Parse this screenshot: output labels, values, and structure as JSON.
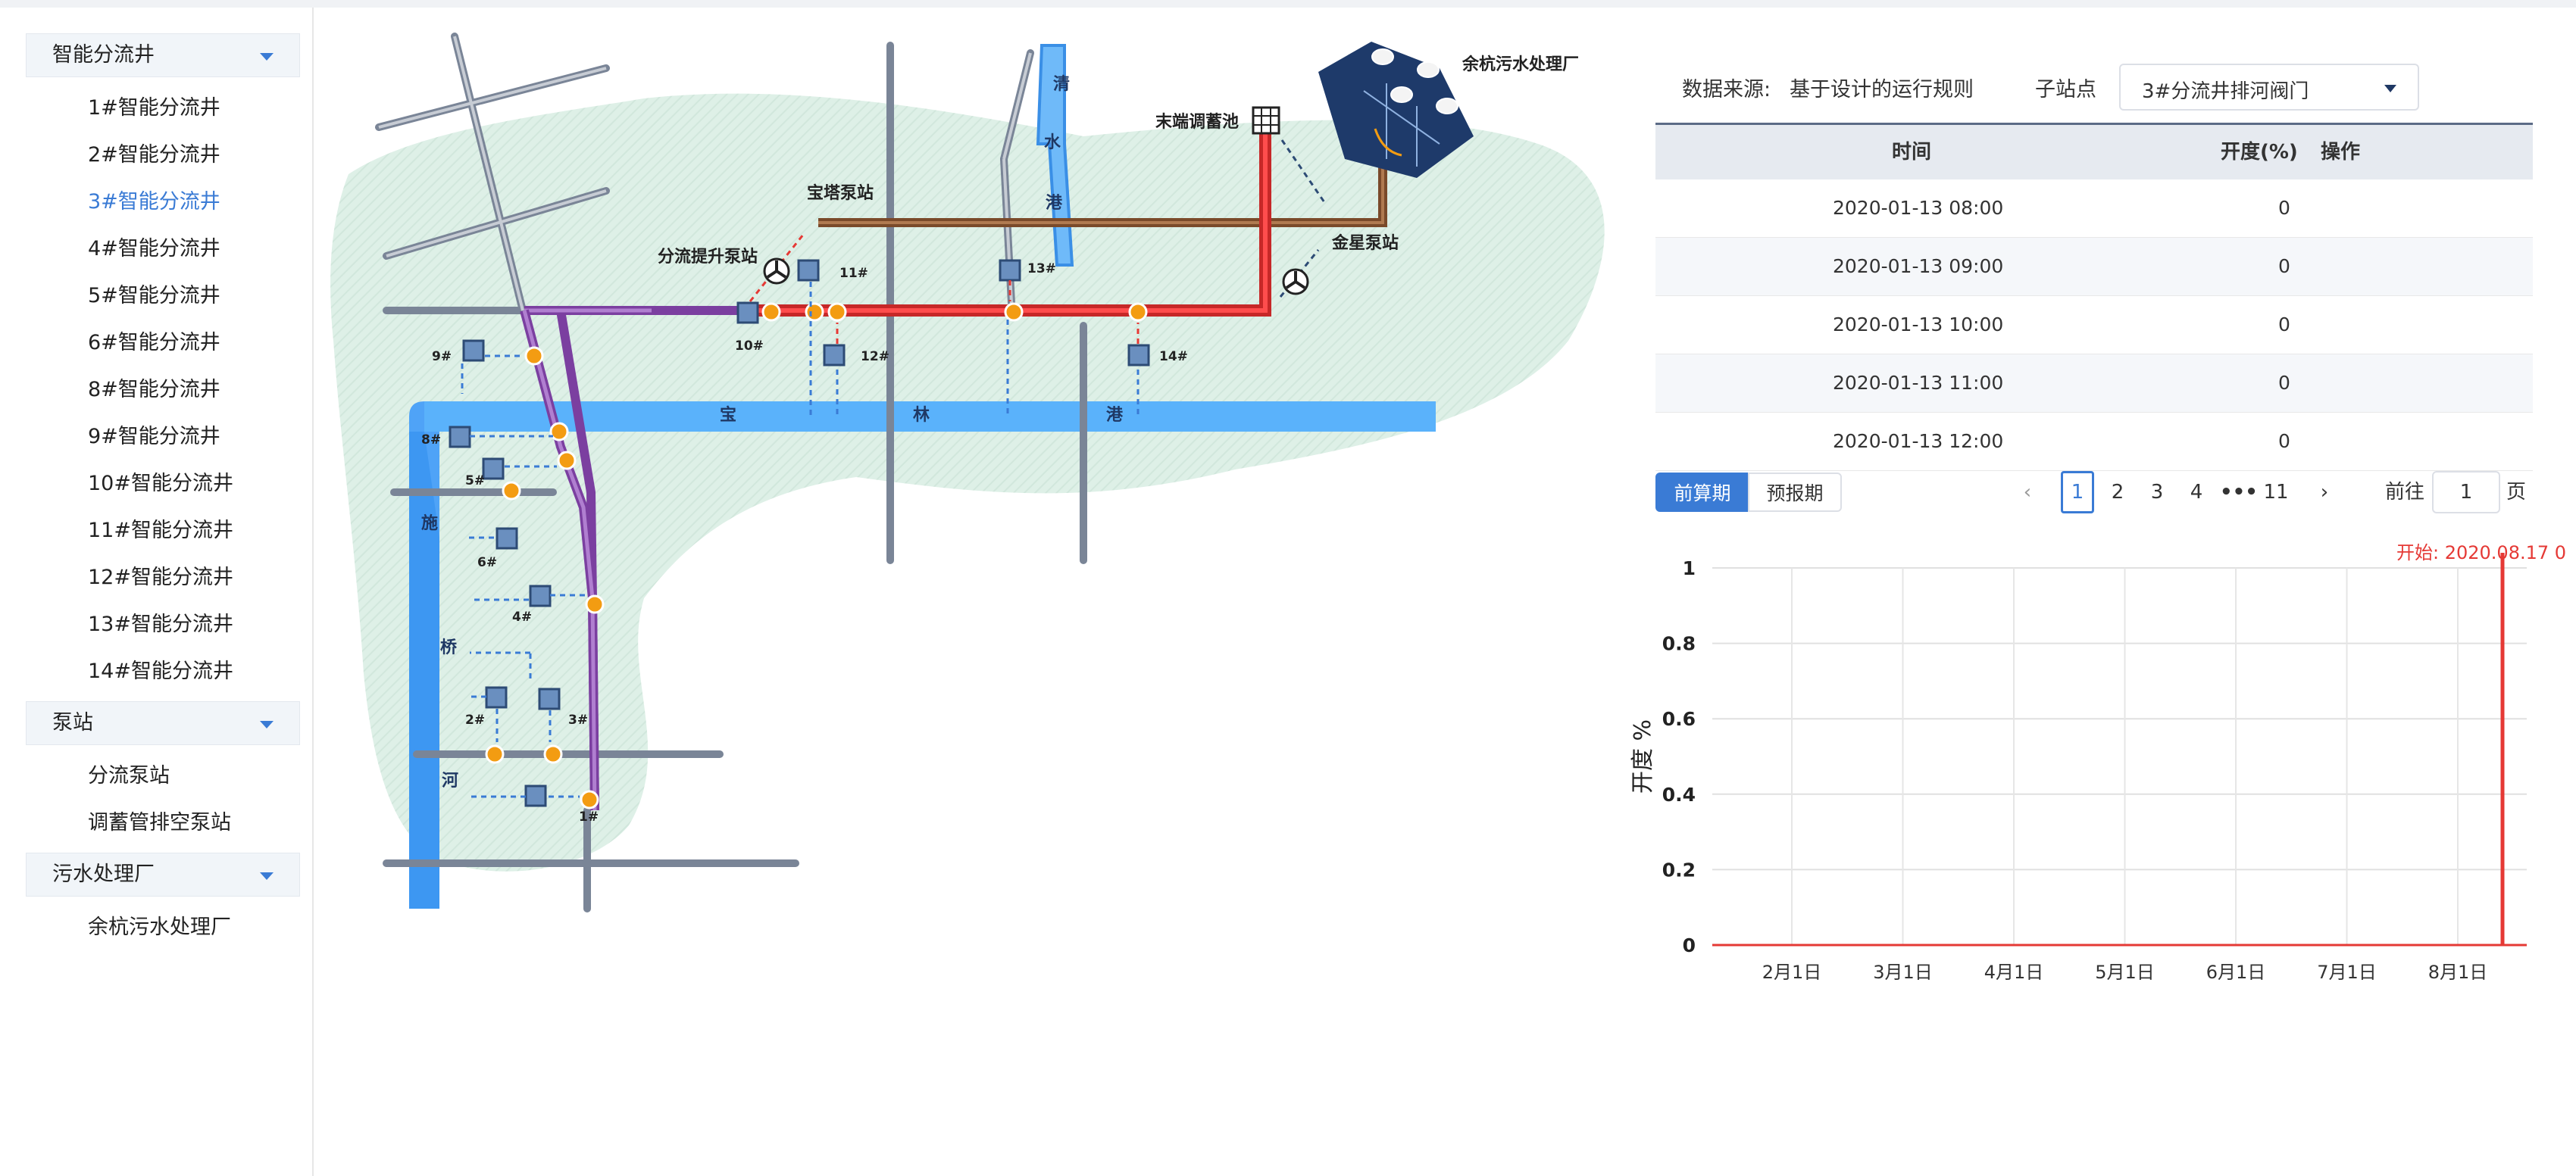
{
  "sidebar": {
    "groups": [
      {
        "label": "智能分流井",
        "items": [
          "1#智能分流井",
          "2#智能分流井",
          "3#智能分流井",
          "4#智能分流井",
          "5#智能分流井",
          "6#智能分流井",
          "8#智能分流井",
          "9#智能分流井",
          "10#智能分流井",
          "11#智能分流井",
          "12#智能分流井",
          "13#智能分流井",
          "14#智能分流井"
        ],
        "active": "3#智能分流井"
      },
      {
        "label": "泵站",
        "items": [
          "分流泵站",
          "调蓄管排空泵站"
        ]
      },
      {
        "label": "污水处理厂",
        "items": [
          "余杭污水处理厂"
        ]
      }
    ]
  },
  "map": {
    "labels": {
      "plant": "余杭污水处理厂",
      "reservoir": "末端调蓄池",
      "baota": "宝塔泵站",
      "pump_lift": "分流提升泵站",
      "jinxing": "金星泵站",
      "river_h1": "宝",
      "river_h2": "林",
      "river_h3": "港",
      "river_v1": "清",
      "river_v2": "水",
      "river_v3": "港",
      "river_l1": "施",
      "river_l2": "桥",
      "river_l3": "河"
    },
    "stations": [
      "1#",
      "2#",
      "3#",
      "4#",
      "5#",
      "6#",
      "8#",
      "9#",
      "10#",
      "11#",
      "12#",
      "13#",
      "14#"
    ]
  },
  "filters": {
    "source_label": "数据来源:",
    "source_value": "基于设计的运行规则",
    "substation_label": "子站点",
    "substation_value": "3#分流井排河阀门"
  },
  "table": {
    "columns": [
      "时间",
      "开度(%)",
      "操作"
    ],
    "rows": [
      {
        "time": "2020-01-13 08:00",
        "value": "0"
      },
      {
        "time": "2020-01-13 09:00",
        "value": "0"
      },
      {
        "time": "2020-01-13 10:00",
        "value": "0"
      },
      {
        "time": "2020-01-13 11:00",
        "value": "0"
      },
      {
        "time": "2020-01-13 12:00",
        "value": "0"
      }
    ]
  },
  "tabs": {
    "active": "前算期",
    "other": "预报期"
  },
  "pager": {
    "pages": [
      "1",
      "2",
      "3",
      "4"
    ],
    "ellipsis": "•••",
    "last": "11",
    "prev": "‹",
    "next": "›",
    "goto_label": "前往",
    "goto_value": "1",
    "page_suffix": "页"
  },
  "colors": {
    "accent": "#3a7bd5",
    "red": "#e53935",
    "purple": "#9b59b6",
    "river": "#4fa3f7",
    "green_area": "#d8efe4"
  },
  "chart_data": {
    "type": "line",
    "ylabel": "开度 %",
    "yticks": [
      "0",
      "0.2",
      "0.4",
      "0.6",
      "0.8",
      "1"
    ],
    "ylim": [
      0,
      1
    ],
    "x": [
      "2月1日",
      "3月1日",
      "4月1日",
      "5月1日",
      "6月1日",
      "7月1日",
      "8月1日"
    ],
    "series": [
      {
        "values": [
          0,
          0,
          0,
          0,
          0,
          0,
          0
        ]
      }
    ],
    "marker_label": "开始: 2020.08.17 0",
    "marker_x": "2020-08-17"
  }
}
